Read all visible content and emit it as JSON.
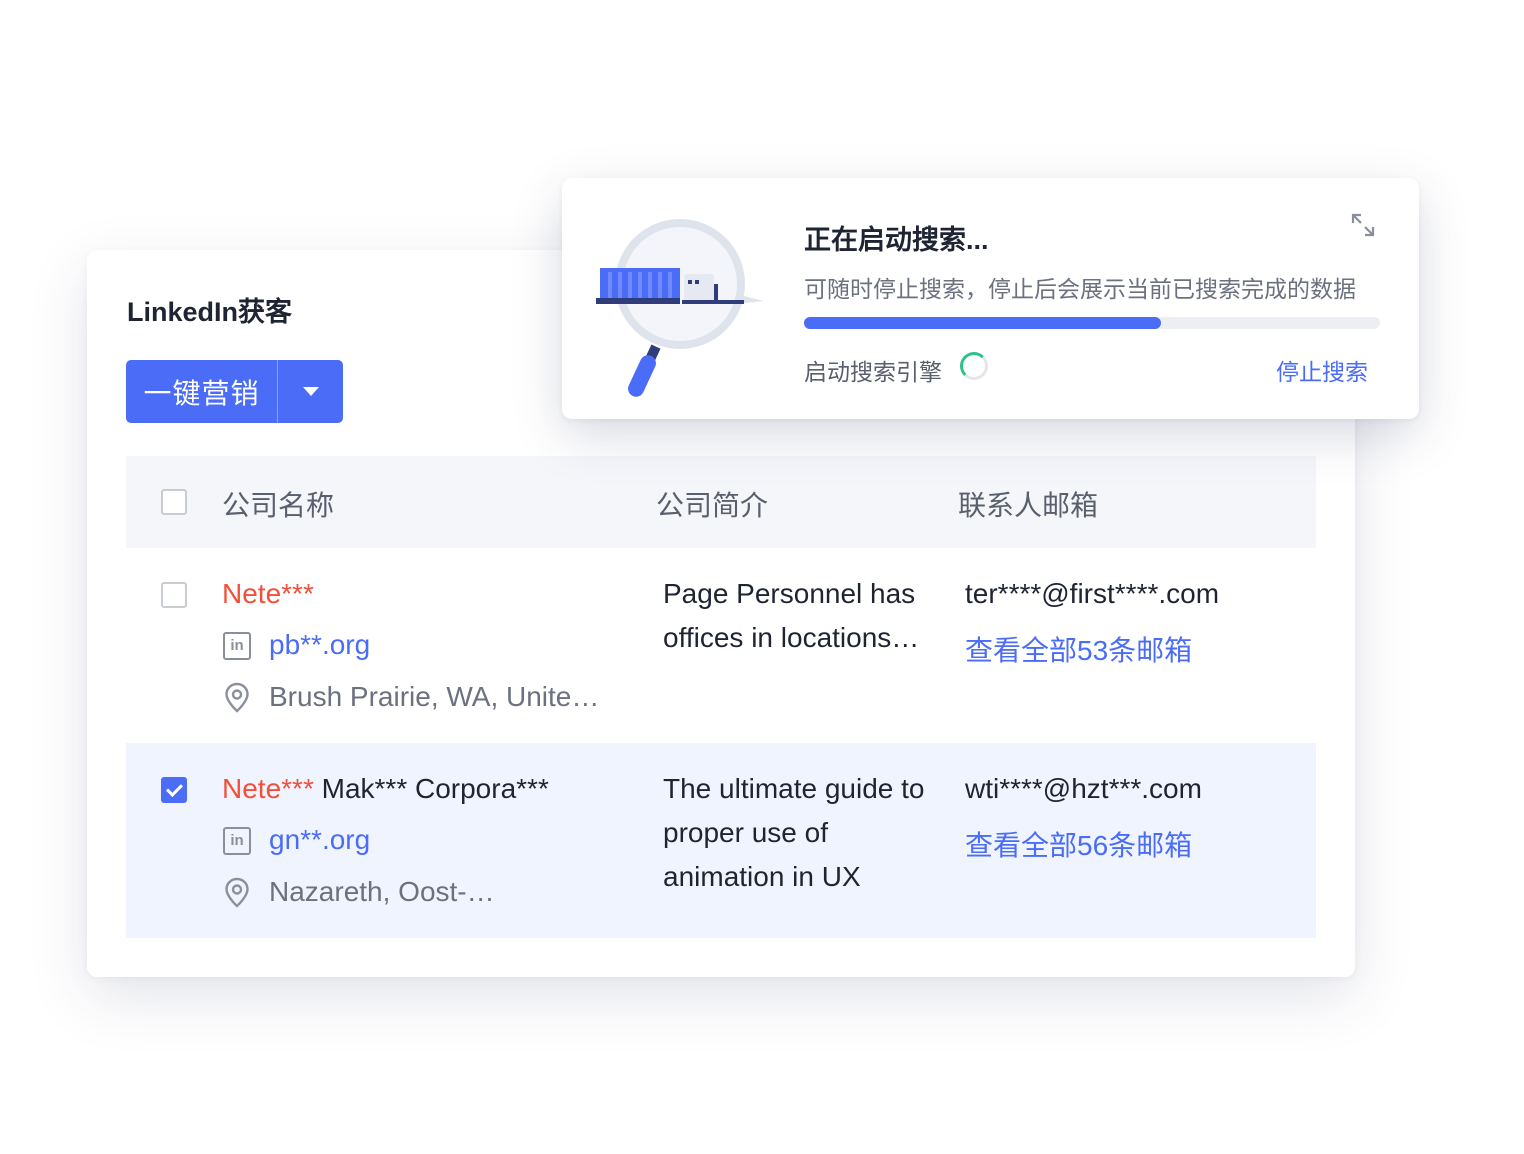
{
  "panel": {
    "title": "LinkedIn获客",
    "marketing_button": "一键营销"
  },
  "table": {
    "headers": [
      "公司名称",
      "公司简介",
      "联系人邮箱"
    ],
    "rows": [
      {
        "checked": false,
        "name_masked": "Nete***",
        "name_rest": "",
        "website": "pb**.org",
        "location": "Brush Prairie, WA, Unite…",
        "description": "Page Personnel has offices in locations…",
        "email": "ter****@first****.com",
        "view_all_emails": "查看全部53条邮箱"
      },
      {
        "checked": true,
        "name_masked": "Nete***",
        "name_rest": "Mak*** Corpora***",
        "website": "gn**.org",
        "location": "Nazareth, Oost-…",
        "description": "The ultimate guide to proper use of animation in UX",
        "email": "wti****@hzt***.com",
        "view_all_emails": "查看全部56条邮箱"
      }
    ]
  },
  "search_popup": {
    "title": "正在启动搜索...",
    "subtitle": "可随时停止搜索，停止后会展示当前已搜索完成的数据",
    "progress_percent": 62,
    "engine_label": "启动搜索引擎",
    "stop_label": "停止搜索"
  },
  "colors": {
    "accent": "#4a6cf7",
    "masked_name": "#f2503a",
    "spinner": "#2ec18a"
  },
  "icons": [
    "linkedin-icon",
    "location-pin-icon",
    "expand-icon",
    "magnifier-illustration",
    "chevron-down-icon"
  ]
}
